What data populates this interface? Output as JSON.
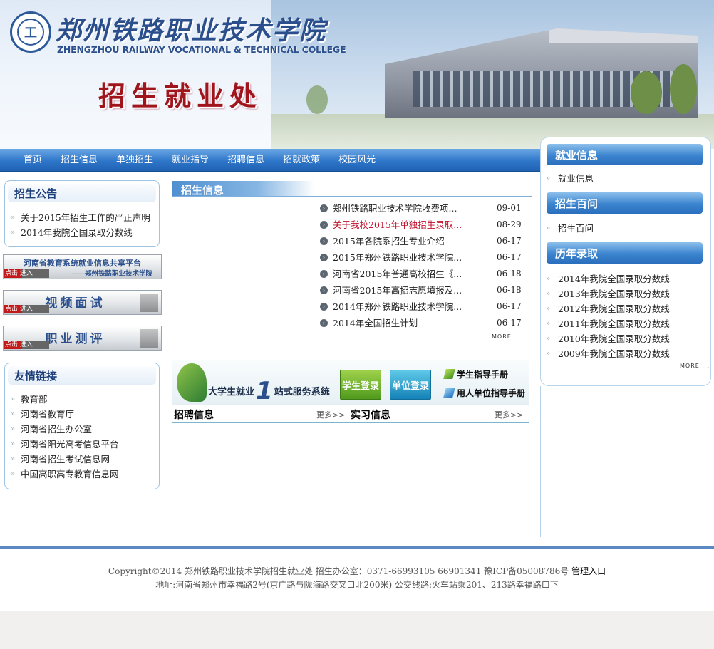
{
  "header": {
    "college_cn": "郑州铁路职业技术学院",
    "college_en": "ZHENGZHOU RAILWAY VOCATIONAL & TECHNICAL COLLEGE",
    "office": "招生就业处"
  },
  "nav": [
    "首页",
    "招生信息",
    "单独招生",
    "就业指导",
    "招聘信息",
    "招就政策",
    "校园风光"
  ],
  "left": {
    "notice_title": "招生公告",
    "notices": [
      "关于2015年招生工作的严正声明",
      "2014年我院全国录取分数线"
    ],
    "promos": [
      {
        "title": "河南省教育系统就业信息共享平台",
        "go": "点击 进入",
        "sub": "——郑州铁路职业技术学院"
      },
      {
        "title": "视频面试",
        "go": "点击 进入"
      },
      {
        "title": "职业测评",
        "go": "点击 进入"
      }
    ],
    "links_title": "友情链接",
    "links": [
      "教育部",
      "河南省教育厅",
      "河南省招生办公室",
      "河南省阳光高考信息平台",
      "河南省招生考试信息网",
      "中国高职高专教育信息网"
    ]
  },
  "center": {
    "title": "招生信息",
    "news": [
      {
        "title": "郑州铁路职业技术学院收费项...",
        "date": "09-01",
        "hot": false
      },
      {
        "title": "关于我校2015年单独招生录取...",
        "date": "08-29",
        "hot": true
      },
      {
        "title": "2015年各院系招生专业介绍",
        "date": "06-17",
        "hot": false
      },
      {
        "title": "2015年郑州铁路职业技术学院...",
        "date": "06-17",
        "hot": false
      },
      {
        "title": "河南省2015年普通高校招生《...",
        "date": "06-18",
        "hot": false
      },
      {
        "title": "河南省2015年高招志愿填报及...",
        "date": "06-18",
        "hot": false
      },
      {
        "title": "2014年郑州铁路职业技术学院...",
        "date": "06-17",
        "hot": false
      },
      {
        "title": "2014年全国招生计划",
        "date": "06-17",
        "hot": false
      }
    ],
    "more": "MORE . .",
    "jobs": {
      "system_a": "大学生就业",
      "system_one": "1",
      "system_b": "站式服务系统",
      "student_login": "学生登录",
      "org_login": "单位登录",
      "student_guide": "学生指导手册",
      "org_guide": "用人单位指导手册",
      "recruit_title": "招聘信息",
      "recruit_more": "更多>>",
      "intern_title": "实习信息",
      "intern_more": "更多>>"
    }
  },
  "right": {
    "employ_title": "就业信息",
    "employ_items": [
      "就业信息"
    ],
    "faq_title": "招生百问",
    "faq_items": [
      "招生百问"
    ],
    "history_title": "历年录取",
    "history_items": [
      "2014年我院全国录取分数线",
      "2013年我院全国录取分数线",
      "2012年我院全国录取分数线",
      "2011年我院全国录取分数线",
      "2010年我院全国录取分数线",
      "2009年我院全国录取分数线"
    ],
    "more": "MORE . ."
  },
  "footer": {
    "line1": "Copyright©2014 郑州铁路职业技术学院招生就业处  招生办公室：0371-66993105 66901341 豫ICP备05008786号",
    "admin": "管理入口",
    "line2": "地址:河南省郑州市幸福路2号(京广路与陇海路交叉口北200米) 公交线路:火车站乘201、213路幸福路口下"
  },
  "colors": {
    "nav_blue": "#2e76c9",
    "title_red": "#a0141c",
    "hot_red": "#c0102a",
    "heading_blue": "#1d3f7a"
  }
}
